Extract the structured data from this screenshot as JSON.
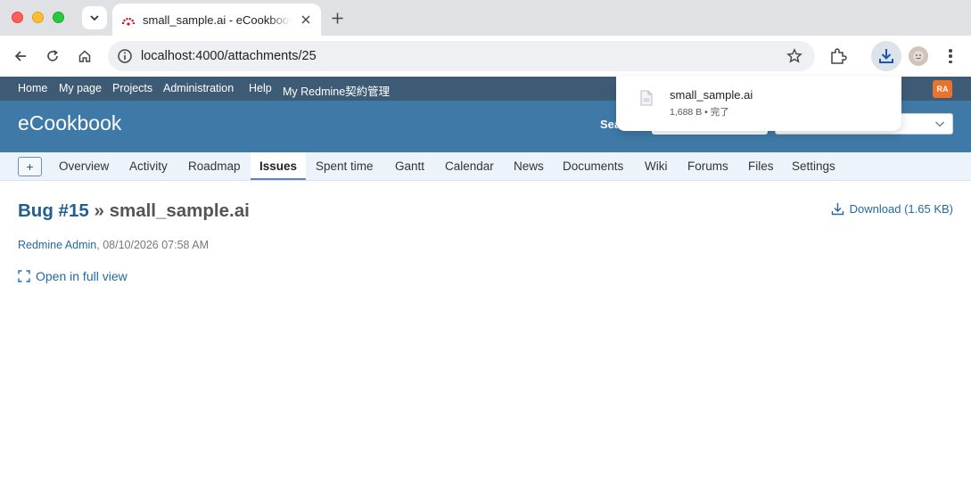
{
  "browser": {
    "tab_title": "small_sample.ai - eCookbook",
    "url": "localhost:4000/attachments/25"
  },
  "download_bubble": {
    "file_name": "small_sample.ai",
    "status": "1,688 B • 完了"
  },
  "top_menu": {
    "items": [
      "Home",
      "My page",
      "Projects",
      "Administration",
      "Help",
      "My Redmine契約管理"
    ],
    "user_badge": "RA"
  },
  "header": {
    "project_title": "eCookbook",
    "search_label": "Sea"
  },
  "main_menu": {
    "new_label": "+",
    "tabs": [
      "Overview",
      "Activity",
      "Roadmap",
      "Issues",
      "Spent time",
      "Gantt",
      "Calendar",
      "News",
      "Documents",
      "Wiki",
      "Forums",
      "Files",
      "Settings"
    ],
    "selected": "Issues"
  },
  "content": {
    "issue_link": "Bug #15",
    "separator": "»",
    "file_title": "small_sample.ai",
    "download_label": "Download (1.65 KB)",
    "author": "Redmine Admin",
    "timestamp": ", 08/10/2026 07:58 AM",
    "fullview_label": "Open in full view"
  },
  "colors": {
    "top_menu_bg": "#3e5b76",
    "header_bg": "#3e79a7",
    "main_menu_bg": "#edf3fa",
    "link": "#2368a5",
    "user_badge": "#e8742b"
  },
  "icons": [
    "tab-search-icon",
    "redmine-favicon",
    "close-icon",
    "plus-icon",
    "back-icon",
    "reload-icon",
    "home-icon",
    "site-info-icon",
    "star-icon",
    "extensions-icon",
    "download-icon",
    "profile-icon",
    "kebab-menu-icon",
    "file-icon",
    "chevron-down-icon",
    "fullscreen-icon"
  ]
}
